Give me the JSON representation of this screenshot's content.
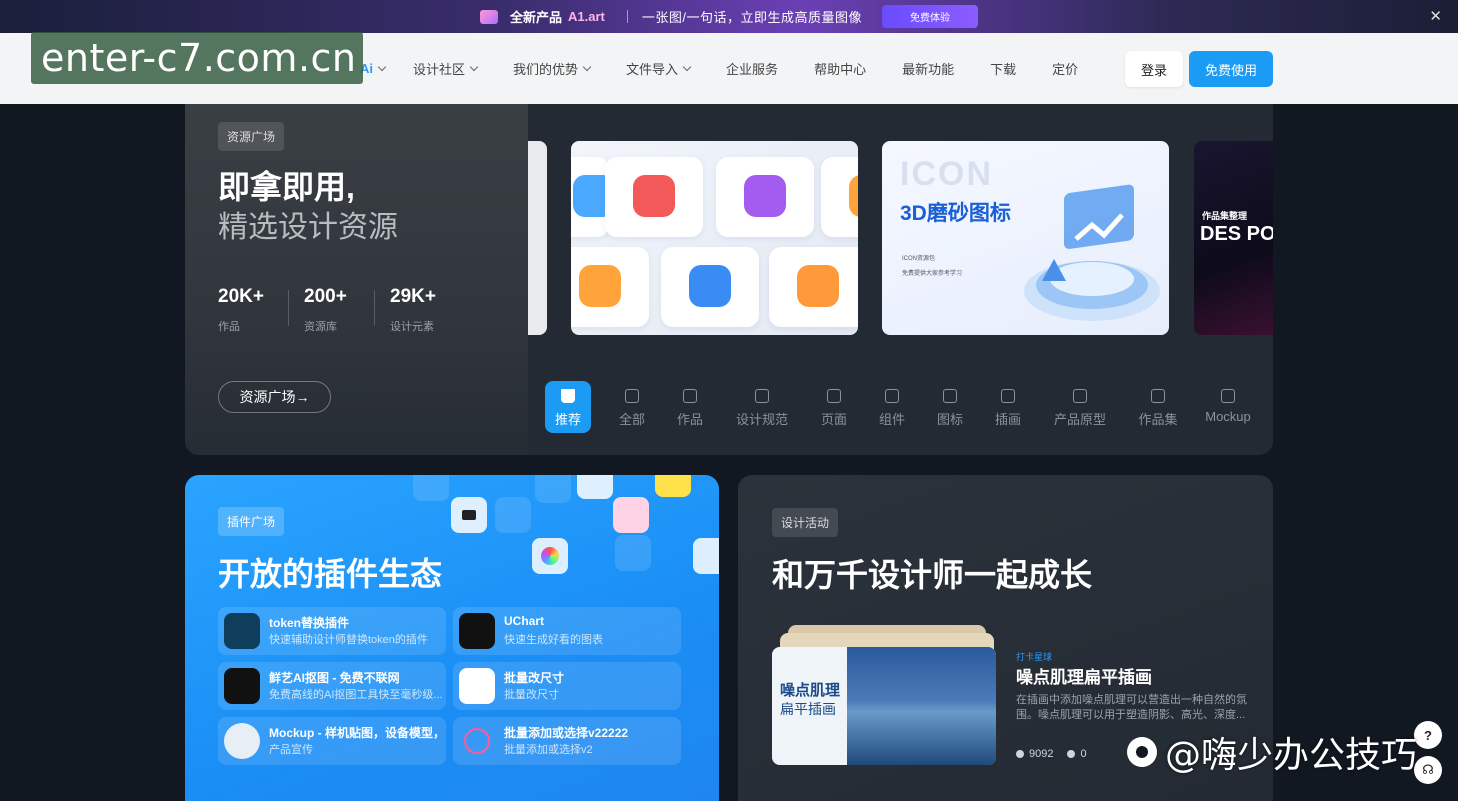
{
  "promo": {
    "new_label": "全新产品",
    "product": "A1.art",
    "slogan": "一张图/一句话，立即生成高质量图像",
    "cta": "免费体验",
    "close": "✕"
  },
  "watermark": "enter-c7.com.cn",
  "nav": {
    "ai": "Ai",
    "items": [
      "设计社区",
      "我们的优势",
      "文件导入",
      "企业服务",
      "帮助中心",
      "最新功能",
      "下载",
      "定价"
    ],
    "login": "登录",
    "free": "免费使用"
  },
  "resources": {
    "tag": "资源广场",
    "title": "即拿即用,",
    "subtitle": "精选设计资源",
    "stats": [
      {
        "num": "20K+",
        "label": "作品"
      },
      {
        "num": "200+",
        "label": "资源库"
      },
      {
        "num": "29K+",
        "label": "设计元素"
      }
    ],
    "cta": "资源广场→",
    "card2": {
      "big": "ICON",
      "title": "3D磨砂图标",
      "line1": "ICON资源包",
      "line2": "免费提供大家参考学习"
    },
    "card3": {
      "small": "作品集整理",
      "big": "DES PORT"
    },
    "tabs": [
      "推荐",
      "全部",
      "作品",
      "设计规范",
      "页面",
      "组件",
      "图标",
      "插画",
      "产品原型",
      "作品集",
      "Mockup"
    ]
  },
  "plugins": {
    "tag": "插件广场",
    "title": "开放的插件生态",
    "items": [
      {
        "title": "token替换插件",
        "desc": "快速辅助设计师替换token的插件"
      },
      {
        "title": "UChart",
        "desc": "快速生成好看的图表"
      },
      {
        "title": "鲜艺AI抠图 - 免费不联网",
        "desc": "免费高线的AI抠图工具快至毫秒级..."
      },
      {
        "title": "批量改尺寸",
        "desc": "批量改尺寸"
      },
      {
        "title": "Mockup - 样机贴图，设备模型，",
        "desc": "产品宣传"
      },
      {
        "title": "批量添加或选择v22222",
        "desc": "批量添加或选择v2"
      }
    ]
  },
  "activity": {
    "tag": "设计活动",
    "title": "和万千设计师一起成长",
    "thumb_line1": "噪点肌理",
    "thumb_line2": "扁平插画",
    "checkin": "打卡星球",
    "item_title": "噪点肌理扁平插画",
    "item_desc": "在插画中添加噪点肌理可以营造出一种自然的氛围。噪点肌理可以用于塑造阴影、高光、深度...",
    "views": "9092",
    "likes": "0"
  },
  "weibo": "@嗨少办公技巧"
}
